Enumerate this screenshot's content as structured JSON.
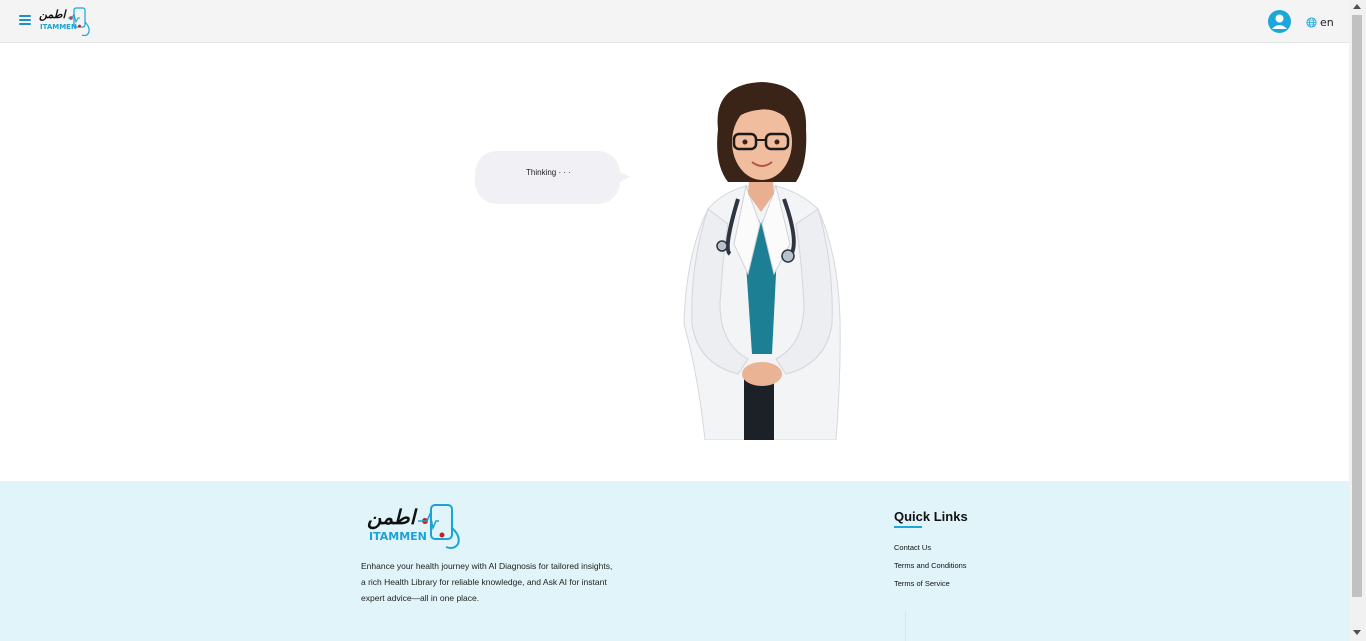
{
  "header": {
    "logo_arabic": "اطمن",
    "logo_english": "ITAMMEN",
    "menu_icon": "hamburger-menu-icon",
    "user_icon": "user-account-icon",
    "language_icon": "globe-icon",
    "language_label": "en"
  },
  "main": {
    "bubble_text": "Thinking · · ·",
    "avatar": "doctor-avatar-illustration"
  },
  "footer": {
    "logo_arabic": "اطمن",
    "logo_english": "ITAMMEN",
    "description_lines": [
      "Enhance your health journey with AI Diagnosis for tailored insights,",
      "a rich Health Library for reliable knowledge, and Ask AI for instant",
      "expert advice—all in one place."
    ],
    "quick_links_title": "Quick Links",
    "quick_links": [
      "Contact Us",
      "Terms and Conditions",
      "Terms of Service"
    ]
  },
  "colors": {
    "accent": "#1ba7dc",
    "header_bg": "#f4f4f4",
    "footer_bg": "#e0f4f9",
    "bubble_bg": "#f1f1f5",
    "logo_red": "#c81e1e"
  }
}
